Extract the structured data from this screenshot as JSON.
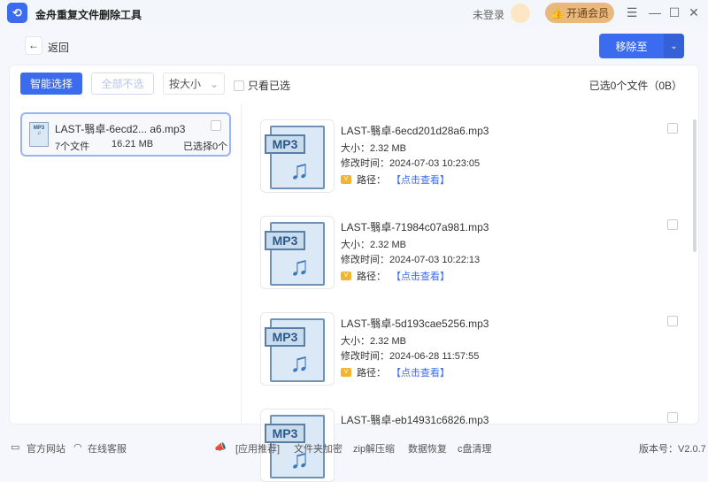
{
  "app": {
    "title": "金舟重复文件删除工具",
    "login": "未登录",
    "vip": "开通会员"
  },
  "nav": {
    "back": "返回",
    "move_to": "移除至"
  },
  "toolbar": {
    "smart_select": "智能选择",
    "deselect_all": "全部不选",
    "sort": "按大小",
    "only_selected": "只看已选",
    "selected_info": "已选0个文件（0B）"
  },
  "group": {
    "name": "LAST-翳卓-6ecd2... a6.mp3",
    "count": "7个文件",
    "size": "16.21 MB",
    "selected": "已选择0个"
  },
  "files": [
    {
      "name": "LAST-翳卓-6ecd201d28a6.mp3",
      "size": "大小：2.32 MB",
      "mtime": "修改时间：2024-07-03 10:23:05",
      "path_label": "路径：",
      "path_link": "【点击查看】"
    },
    {
      "name": "LAST-翳卓-71984c07a981.mp3",
      "size": "大小：2.32 MB",
      "mtime": "修改时间：2024-07-03 10:22:13",
      "path_label": "路径：",
      "path_link": "【点击查看】"
    },
    {
      "name": "LAST-翳卓-5d193cae5256.mp3",
      "size": "大小：2.32 MB",
      "mtime": "修改时间：2024-06-28 11:57:55",
      "path_label": "路径：",
      "path_link": "【点击查看】"
    },
    {
      "name": "LAST-翳卓-eb14931c6826.mp3"
    }
  ],
  "icon_label": "MP3",
  "footer": {
    "website": "官方网站",
    "support": "在线客服",
    "recommend": "[应用推荐]",
    "links": [
      "文件夹加密",
      "zip解压缩",
      "数据恢复",
      "c盘清理"
    ],
    "version": "版本号：V2.0.7"
  }
}
